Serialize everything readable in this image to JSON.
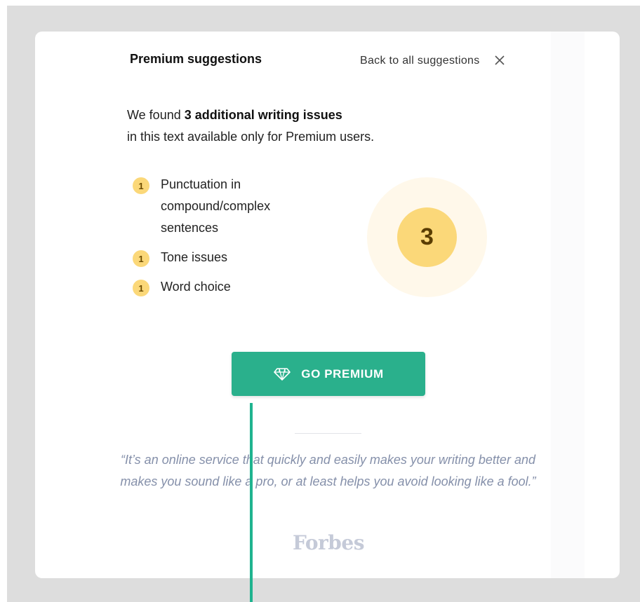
{
  "panel": {
    "title": "Premium suggestions",
    "back_link": "Back to all suggestions",
    "close_icon": "close-icon"
  },
  "intro": {
    "prefix": "We found ",
    "highlight": "3 additional writing issues",
    "suffix": "in this text available only for Premium users."
  },
  "issues": [
    {
      "count": "1",
      "label": "Punctuation in compound/complex sentences"
    },
    {
      "count": "1",
      "label": "Tone issues"
    },
    {
      "count": "1",
      "label": "Word choice"
    }
  ],
  "total_issues": "3",
  "cta": {
    "label": "GO PREMIUM",
    "icon": "diamond-icon"
  },
  "testimonial": {
    "quote": "“It’s an online service that quickly and easily makes your writing better and makes you sound like a pro, or at least helps you avoid looking like a fool.”",
    "source": "Forbes"
  },
  "colors": {
    "accent": "#2ab08c",
    "badge": "#fbd879",
    "quote_text": "#8590aa"
  }
}
